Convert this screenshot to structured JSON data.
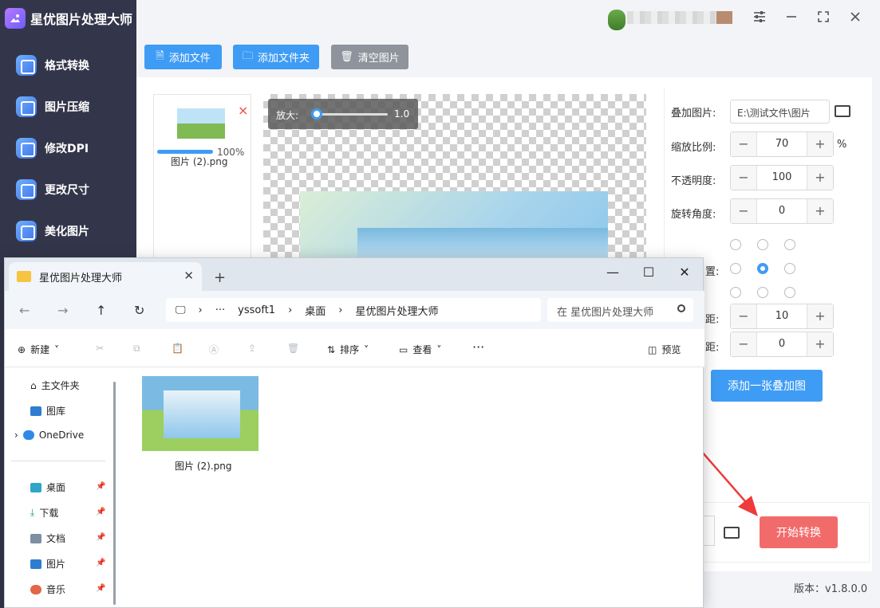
{
  "app": {
    "title": "星优图片处理大师",
    "nav": [
      "格式转换",
      "图片压缩",
      "修改DPI",
      "更改尺寸",
      "美化图片"
    ],
    "toolbar": {
      "add_file": "添加文件",
      "add_folder": "添加文件夹",
      "clear": "清空图片"
    },
    "file": {
      "name": "图片 (2).png",
      "progress": "100%",
      "close": "×"
    },
    "zoom": {
      "label": "放大:",
      "value": "1.0"
    },
    "settings": {
      "overlay_image_label": "叠加图片:",
      "overlay_image_path": "E:\\测试文件\\图片",
      "scale_label": "缩放比例:",
      "scale_value": "70",
      "scale_unit": "%",
      "opacity_label": "不透明度:",
      "opacity_value": "100",
      "rotation_label": "旋转角度:",
      "rotation_value": "0",
      "position_label_partial": "置:",
      "spacing_h_label_partial": "距:",
      "spacing_h_value": "10",
      "spacing_v_label_partial": "距:",
      "spacing_v_value": "0",
      "add_overlay": "添加一张叠加图",
      "minus": "−",
      "plus": "+"
    },
    "start_button": "开始转换",
    "version": "版本：v1.8.0.0"
  },
  "explorer": {
    "tab_title": "星优图片处理大师",
    "breadcrumb": [
      "yssoft1",
      "桌面",
      "星优图片处理大师"
    ],
    "search_placeholder": "在 星优图片处理大师",
    "toolbar": {
      "new": "新建",
      "sort": "排序",
      "view": "查看",
      "more": "···",
      "preview": "预览"
    },
    "sidebar": {
      "home": "主文件夹",
      "gallery": "图库",
      "onedrive": "OneDrive",
      "desktop": "桌面",
      "downloads": "下载",
      "documents": "文档",
      "pictures": "图片",
      "music": "音乐"
    },
    "file": {
      "name": "图片 (2).png"
    }
  },
  "colors": {
    "accent": "#3f9cf5",
    "start": "#f26b6b",
    "sidebar": "#33364a",
    "clear_btn": "#8e939c"
  }
}
